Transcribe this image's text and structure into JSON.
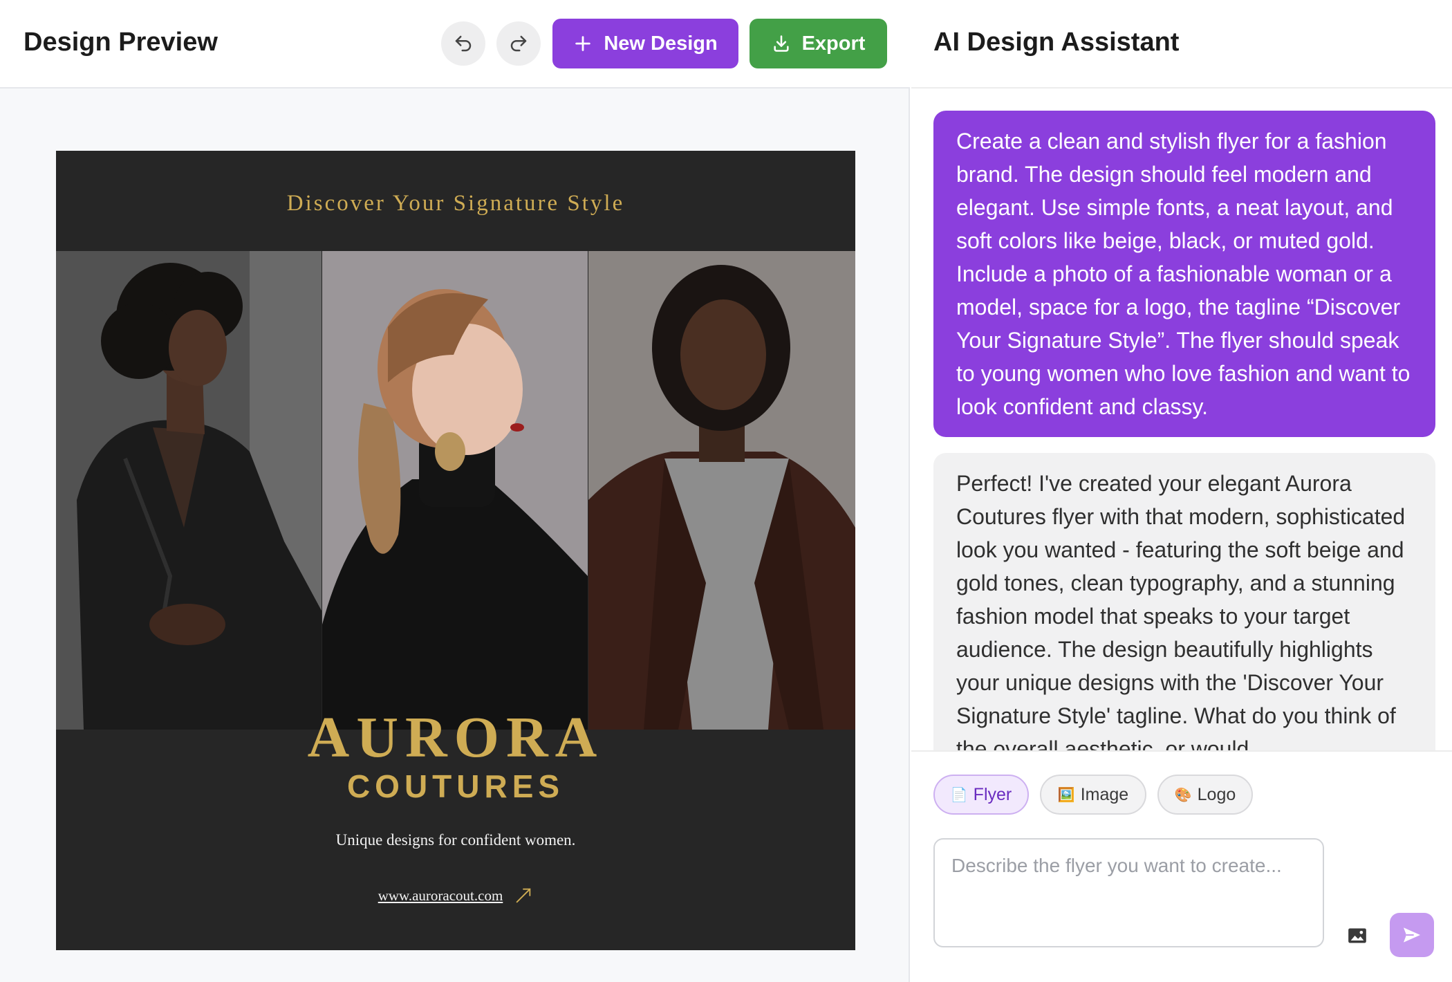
{
  "preview": {
    "title": "Design Preview",
    "new_design_label": "New Design",
    "export_label": "Export",
    "undo_icon": "undo-icon",
    "redo_icon": "redo-icon"
  },
  "flyer": {
    "tagline": "Discover Your Signature Style",
    "brand_line1": "AURORA",
    "brand_line2": "COUTURES",
    "subtitle": "Unique designs for confident women.",
    "url": "www.auroracout.com",
    "colors": {
      "background": "#262626",
      "gold": "#cfac54",
      "text": "#f2f2f2"
    }
  },
  "assistant": {
    "title": "AI Design Assistant",
    "messages": [
      {
        "role": "user",
        "text": "Create a clean and stylish flyer for a fashion brand. The design should feel modern and elegant. Use simple fonts, a neat layout, and soft colors like beige, black, or muted gold. Include a photo of a fashionable woman or a model, space for a logo, the tagline “Discover Your Signature Style”. The flyer should speak to young women who love fashion and want to look confident and classy."
      },
      {
        "role": "assistant",
        "text": "Perfect! I've created your elegant Aurora Coutures flyer with that modern, sophisticated look you wanted - featuring the soft beige and gold tones, clean typography, and a stunning fashion model that speaks to your target audience. The design beautifully highlights your unique designs with the 'Discover Your Signature Style' tagline. What do you think of the overall aesthetic, or would"
      }
    ],
    "modes": [
      {
        "label": "Flyer",
        "icon": "📄",
        "selected": true
      },
      {
        "label": "Image",
        "icon": "🖼️",
        "selected": false
      },
      {
        "label": "Logo",
        "icon": "🎨",
        "selected": false
      }
    ],
    "input_placeholder": "Describe the flyer you want to create...",
    "input_value": ""
  },
  "colors": {
    "accent": "#8b3fdd",
    "export": "#43a047",
    "send_disabled": "#c59af0"
  }
}
